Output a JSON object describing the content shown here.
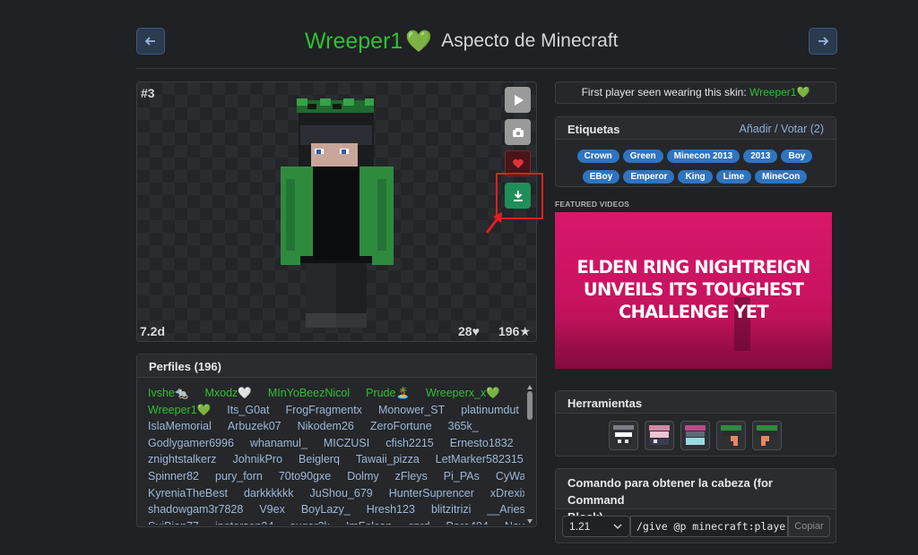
{
  "header": {
    "skin_name": "Wreeper1",
    "heart": "💚",
    "subtitle": "Aspecto de Minecraft"
  },
  "viewer": {
    "rank": "#3",
    "age": "7.2d",
    "likes": "28♥",
    "stars": "196★"
  },
  "first_seen": {
    "text": "First player seen wearing this skin:",
    "player": "Wreeper1💚"
  },
  "tags_panel": {
    "title": "Etiquetas",
    "action": "Añadir / Votar (2)",
    "tags": [
      "Crown",
      "Green",
      "Minecon 2013",
      "2013",
      "Boy",
      "EBoy",
      "Emperor",
      "King",
      "Lime",
      "MineCon"
    ]
  },
  "featured": {
    "label": "FEATURED VIDEOS",
    "video_title": [
      "ELDEN RING NIGHTREIGN",
      "UNVEILS ITS TOUGHEST",
      "CHALLENGE YET"
    ]
  },
  "profiles": {
    "title": "Perfiles (196)",
    "rows": [
      [
        {
          "n": "Ivshe🐀",
          "g": true
        },
        {
          "n": "Mxodz🤍",
          "g": true
        },
        {
          "n": "MInYoBeezNicol",
          "g": true
        },
        {
          "n": "Prude🏝️",
          "g": true
        },
        {
          "n": "Wreeperx_x💚",
          "g": true
        }
      ],
      [
        {
          "n": "Wreeper1💚",
          "g": true
        },
        {
          "n": "Its_G0at",
          "g": false
        },
        {
          "n": "FrogFragmentx",
          "g": false
        },
        {
          "n": "Monower_ST",
          "g": false
        },
        {
          "n": "platinumdut",
          "g": false
        }
      ],
      [
        {
          "n": "IslaMemorial",
          "g": false
        },
        {
          "n": "Arbuzek07",
          "g": false
        },
        {
          "n": "Nikodem26",
          "g": false
        },
        {
          "n": "ZeroFortune",
          "g": false
        },
        {
          "n": "365k_",
          "g": false
        }
      ],
      [
        {
          "n": "Godlygamer6996",
          "g": false
        },
        {
          "n": "whanamul_",
          "g": false
        },
        {
          "n": "MICZUSI",
          "g": false
        },
        {
          "n": "cfish2215",
          "g": false
        },
        {
          "n": "Ernesto1832",
          "g": false
        }
      ],
      [
        {
          "n": "znightstalkerz",
          "g": false
        },
        {
          "n": "JohnikPro",
          "g": false
        },
        {
          "n": "Beiglerq",
          "g": false
        },
        {
          "n": "Tawaii_pizza",
          "g": false
        },
        {
          "n": "LetMarker582315",
          "g": false
        }
      ],
      [
        {
          "n": "Spinner82",
          "g": false
        },
        {
          "n": "pury_forn",
          "g": false
        },
        {
          "n": "70to90gxe",
          "g": false
        },
        {
          "n": "Dolmy",
          "g": false
        },
        {
          "n": "zFleys",
          "g": false
        },
        {
          "n": "Pi_PAs",
          "g": false
        },
        {
          "n": "CyWalk",
          "g": false
        }
      ],
      [
        {
          "n": "KyreniaTheBest",
          "g": false
        },
        {
          "n": "darkkkkkk",
          "g": false
        },
        {
          "n": "JuShou_679",
          "g": false
        },
        {
          "n": "HunterSuprencer",
          "g": false
        },
        {
          "n": "xDrexixX",
          "g": false
        }
      ],
      [
        {
          "n": "shadowgam3r7828",
          "g": false
        },
        {
          "n": "V9ex",
          "g": false
        },
        {
          "n": "BoyLazy_",
          "g": false
        },
        {
          "n": "Hresh123",
          "g": false
        },
        {
          "n": "blitzitrizi",
          "g": false
        },
        {
          "n": "__Aries_",
          "g": false
        }
      ],
      [
        {
          "n": "SuiBian77",
          "g": false
        },
        {
          "n": "jpetersen24",
          "g": false
        },
        {
          "n": "sugar3k",
          "g": false
        },
        {
          "n": "ImFolcan",
          "g": false
        },
        {
          "n": "cprd",
          "g": false
        },
        {
          "n": "Pare404",
          "g": false
        },
        {
          "n": "NovaOWisp",
          "g": false
        }
      ]
    ]
  },
  "tools": {
    "title": "Herramientas"
  },
  "command": {
    "title_line1": "Comando para obtener la cabeza (for Command",
    "title_line2": "Block)",
    "version": "1.21",
    "command_text": "/give @p minecraft:player_",
    "copy_label": "Copiar"
  },
  "colors": {
    "accent_green": "#2fc12f",
    "tag_blue": "#2f74c0",
    "download_green": "#1e8f5a",
    "highlight_red": "#e02020",
    "video_magenta": "#c4115f"
  }
}
